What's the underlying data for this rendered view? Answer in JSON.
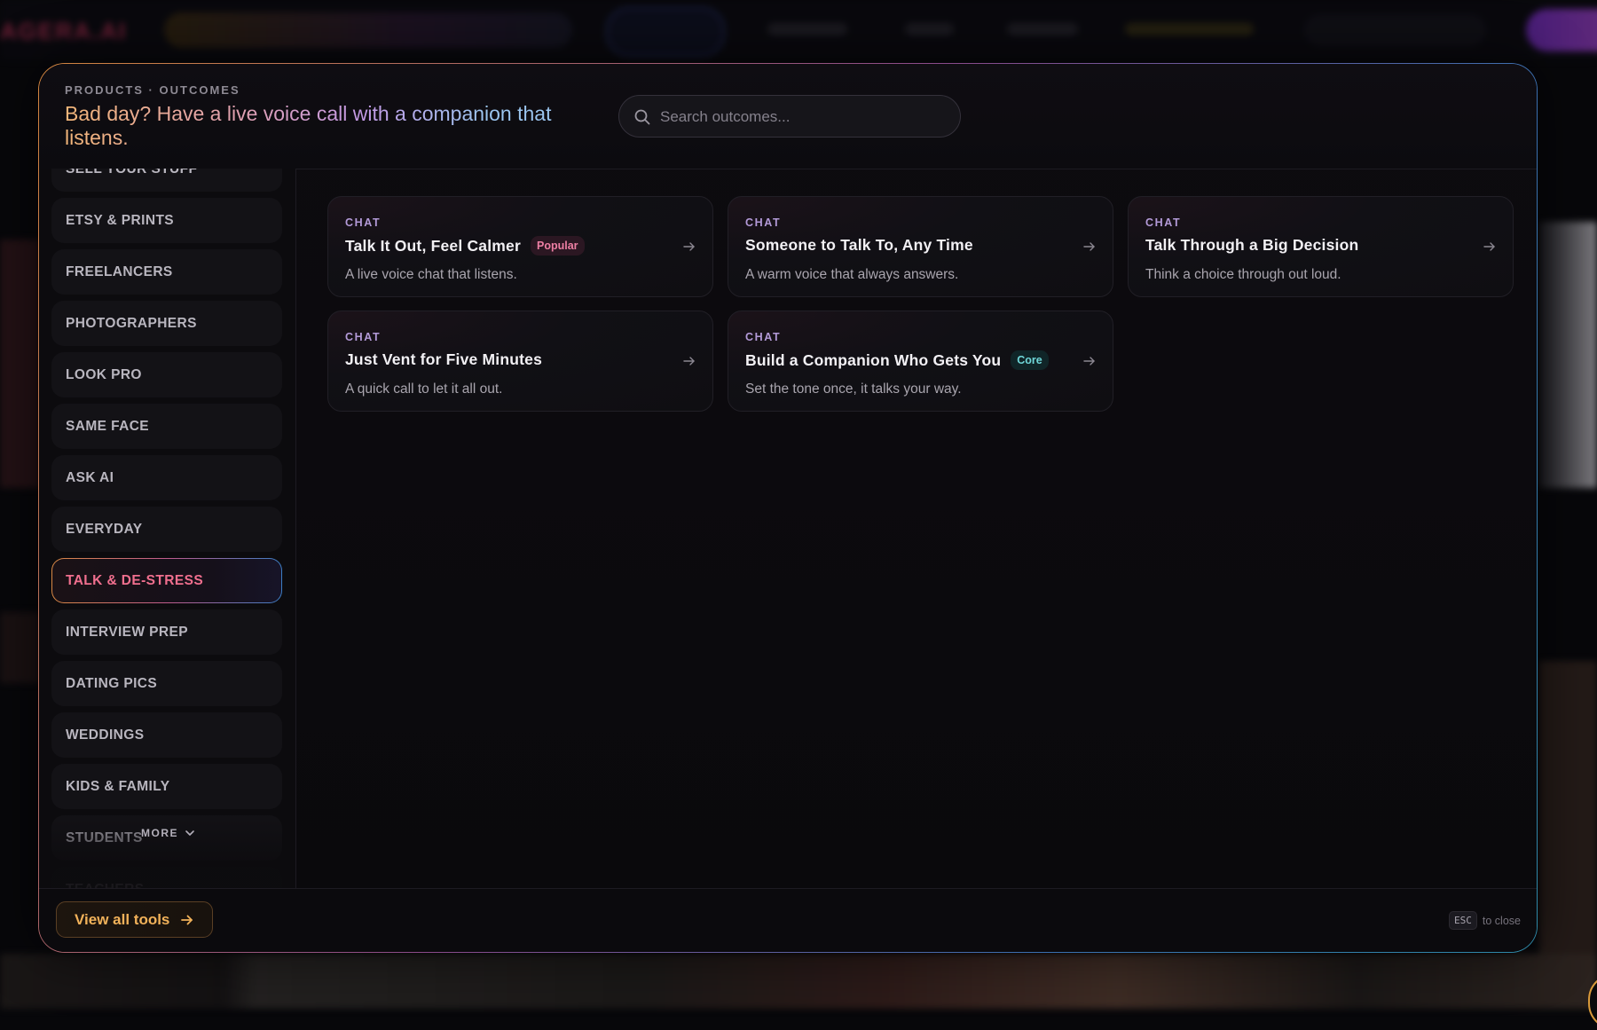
{
  "breadcrumb": "PRODUCTS · OUTCOMES",
  "headline": "Bad day? Have a live voice call with a companion that listens.",
  "search": {
    "placeholder": "Search outcomes..."
  },
  "sidebar": {
    "items": [
      {
        "label": "SELL YOUR STUFF",
        "active": false
      },
      {
        "label": "ETSY & PRINTS",
        "active": false
      },
      {
        "label": "FREELANCERS",
        "active": false
      },
      {
        "label": "PHOTOGRAPHERS",
        "active": false
      },
      {
        "label": "LOOK PRO",
        "active": false
      },
      {
        "label": "SAME FACE",
        "active": false
      },
      {
        "label": "ASK AI",
        "active": false
      },
      {
        "label": "EVERYDAY",
        "active": false
      },
      {
        "label": "TALK & DE-STRESS",
        "active": true
      },
      {
        "label": "INTERVIEW PREP",
        "active": false
      },
      {
        "label": "DATING PICS",
        "active": false
      },
      {
        "label": "WEDDINGS",
        "active": false
      },
      {
        "label": "KIDS & FAMILY",
        "active": false
      },
      {
        "label": "STUDENTS",
        "active": false
      },
      {
        "label": "TEACHERS",
        "active": false
      }
    ],
    "more_label": "MORE"
  },
  "cards": [
    {
      "tag": "CHAT",
      "title": "Talk It Out, Feel Calmer",
      "badge": "Popular",
      "badge_type": "popular",
      "description": "A live voice chat that listens."
    },
    {
      "tag": "CHAT",
      "title": "Someone to Talk To, Any Time",
      "badge": "",
      "badge_type": "",
      "description": "A warm voice that always answers."
    },
    {
      "tag": "CHAT",
      "title": "Talk Through a Big Decision",
      "badge": "",
      "badge_type": "",
      "description": "Think a choice through out loud."
    },
    {
      "tag": "CHAT",
      "title": "Just Vent for Five Minutes",
      "badge": "",
      "badge_type": "",
      "description": "A quick call to let it all out."
    },
    {
      "tag": "CHAT",
      "title": "Build a Companion Who Gets You",
      "badge": "Core",
      "badge_type": "core",
      "description": "Set the tone once, it talks your way."
    }
  ],
  "footer": {
    "view_all_label": "View all tools",
    "esc_key": "ESC",
    "esc_hint": "to close"
  },
  "colors": {
    "accent_gold": "#f2b25a",
    "active_pink": "#f06f8e",
    "tag_purple": "#b39ad8",
    "popular_badge": "#ee7fa4",
    "core_badge": "#6fd6d8"
  },
  "icons": {
    "search": "search-icon",
    "card_arrow": "arrow-right-icon",
    "more": "chevron-down-icon",
    "view_all": "arrow-right-icon"
  }
}
